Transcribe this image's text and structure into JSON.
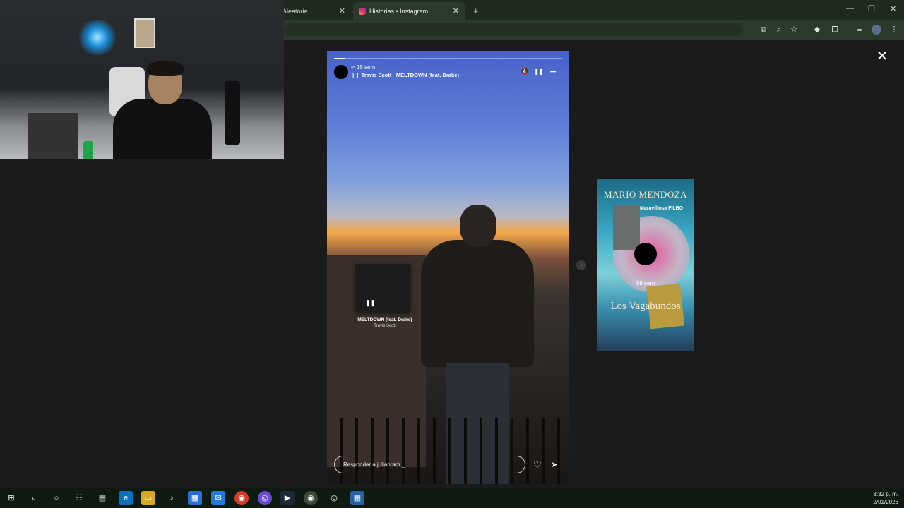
{
  "browser": {
    "tabs": [
      {
        "label": "Aleatoria",
        "active": false
      },
      {
        "label": "Historias • Instagram",
        "active": true
      }
    ],
    "new_tab": "+",
    "window_controls": {
      "minimize": "—",
      "restore": "❐",
      "close": "✕"
    }
  },
  "story": {
    "progress": 0.05,
    "time": "15 sem",
    "time_prefix": "∞",
    "song": "Travis Scott · MELTDOWN (feat. Drake)",
    "song_icon": "❘❘",
    "sticker_title": "MELTDOWN (feat. Drake)",
    "sticker_artist": "Travis Scott",
    "reply_placeholder": "Responder a julianram._",
    "icons": {
      "mute": "🔇",
      "pause": "❚❚",
      "more": "•••",
      "heart": "♡",
      "send": "➤",
      "close": "✕",
      "next": "›",
      "sticker_pause": "❚❚"
    }
  },
  "next_story": {
    "title": "MARIO MENDOZA",
    "caption": "Maravillosa FILBO",
    "time": "88 sem",
    "book_title": "Los Vagabundos"
  },
  "taskbar": {
    "time": "8:32 p. m.",
    "date": "2/01/2026",
    "items": [
      "⊞",
      "⌕",
      "○",
      "☷",
      "▤",
      "e",
      "▭",
      "♪",
      "▦",
      "✉",
      "◉",
      "◎",
      "▶",
      "◉",
      "◎",
      "▦"
    ]
  },
  "colors": {
    "accent_ig": "#e1306c",
    "chrome_bg": "#2b3a2b",
    "taskbar_bg": "#0f1a10"
  }
}
